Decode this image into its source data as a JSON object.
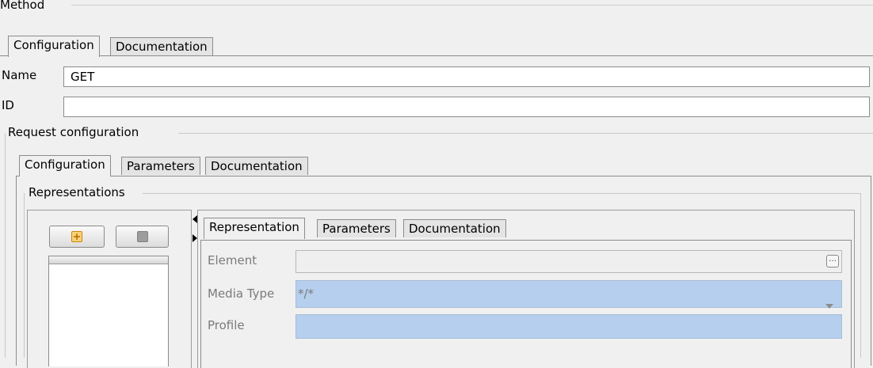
{
  "section": {
    "title": "Method"
  },
  "top_tabs": [
    {
      "label": "Configuration",
      "active": true
    },
    {
      "label": "Documentation",
      "active": false
    }
  ],
  "fields": {
    "name_label": "Name",
    "name_value": "GET",
    "id_label": "ID",
    "id_value": ""
  },
  "request": {
    "title": "Request configuration",
    "tabs": [
      {
        "label": "Configuration",
        "active": true
      },
      {
        "label": "Parameters",
        "active": false
      },
      {
        "label": "Documentation",
        "active": false
      }
    ],
    "representations_title": "Representations"
  },
  "representation": {
    "tabs": [
      {
        "label": "Representation",
        "active": true
      },
      {
        "label": "Parameters",
        "active": false
      },
      {
        "label": "Documentation",
        "active": false
      }
    ],
    "element_label": "Element",
    "element_value": "",
    "element_button": "…",
    "media_type_label": "Media Type",
    "media_type_value": "*/*",
    "profile_label": "Profile",
    "profile_value": ""
  },
  "icons": {
    "add": "plus-icon",
    "remove": "minus-icon",
    "browse": "ellipsis-icon",
    "dropdown": "chevron-down-icon",
    "splitter": "arrow-left-icon"
  },
  "colors": {
    "selection": "#b6cfee",
    "add_icon": "#f3a91f"
  }
}
